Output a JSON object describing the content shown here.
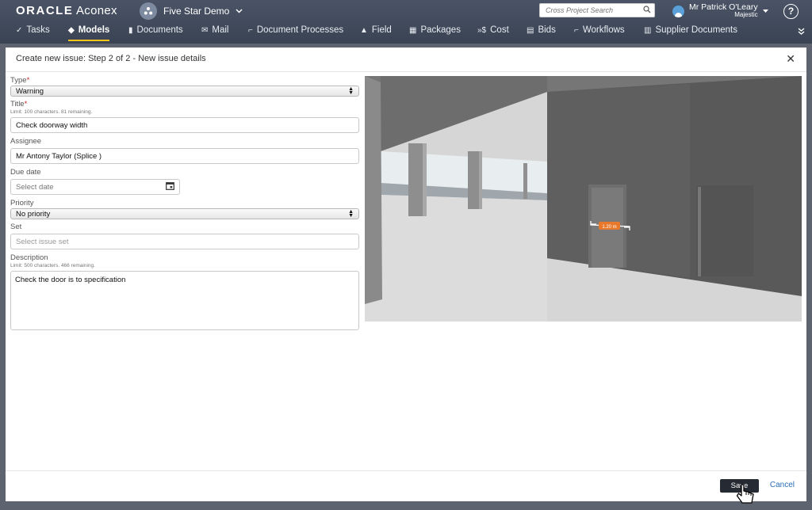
{
  "header": {
    "logo_brand": "ORACLE",
    "logo_product": "Aconex",
    "project_name": "Five Star Demo",
    "search_placeholder": "Cross Project Search",
    "user_name": "Mr Patrick O'Leary",
    "user_org": "Majestic",
    "help_label": "?"
  },
  "nav": [
    {
      "label": "Tasks",
      "icon": "check-icon",
      "active": false
    },
    {
      "label": "Models",
      "icon": "cube-icon",
      "active": true
    },
    {
      "label": "Documents",
      "icon": "document-icon",
      "active": false
    },
    {
      "label": "Mail",
      "icon": "mail-icon",
      "active": false
    },
    {
      "label": "Document Processes",
      "icon": "workflow-icon",
      "active": false
    },
    {
      "label": "Field",
      "icon": "field-icon",
      "active": false
    },
    {
      "label": "Packages",
      "icon": "packages-icon",
      "active": false
    },
    {
      "label": "Cost",
      "icon": "cost-icon",
      "active": false
    },
    {
      "label": "Bids",
      "icon": "bids-icon",
      "active": false
    },
    {
      "label": "Workflows",
      "icon": "workflow-icon",
      "active": false
    },
    {
      "label": "Supplier Documents",
      "icon": "supplier-icon",
      "active": false
    }
  ],
  "modal": {
    "title": "Create new issue: Step 2 of 2 - New issue details",
    "fields": {
      "type_label": "Type",
      "type_value": "Warning",
      "title_label": "Title",
      "title_hint": "Limit: 100 characters. 81 remaining.",
      "title_value": "Check doorway width",
      "assignee_label": "Assignee",
      "assignee_value": "Mr Antony Taylor (Splice )",
      "due_label": "Due date",
      "due_placeholder": "Select date",
      "priority_label": "Priority",
      "priority_value": "No priority",
      "set_label": "Set",
      "set_placeholder": "Select issue set",
      "description_label": "Description",
      "description_hint": "Limit: 500 characters. 466 remaining.",
      "description_value": "Check the door is to specification"
    },
    "viewer": {
      "measurement": "1.20 m"
    },
    "save_label": "Save",
    "cancel_label": "Cancel"
  },
  "colors": {
    "topbar": "#3e4757",
    "active_underline": "#f0c419",
    "save_button": "#262b33",
    "link": "#2a6db3",
    "measure_tag": "#e8792c"
  }
}
